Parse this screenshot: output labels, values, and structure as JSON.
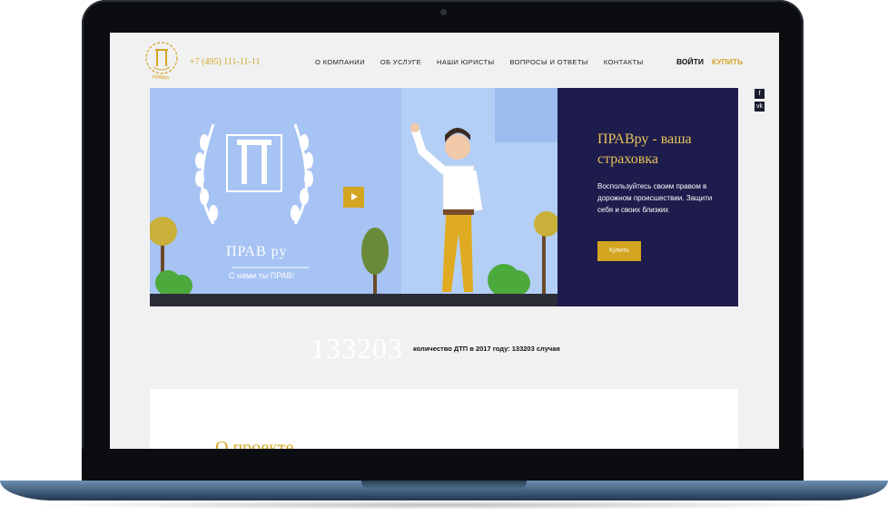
{
  "header": {
    "logo_caption": "ПРАВру",
    "phone": "+7 (495) 111-11-11",
    "nav": [
      "О компании",
      "Об услуге",
      "Наши юристы",
      "Вопросы и ответы",
      "Контакты"
    ],
    "login_label": "ВОЙТИ",
    "buy_label": "КУПИТЬ"
  },
  "social": [
    {
      "icon": "facebook-icon",
      "glyph": "f"
    },
    {
      "icon": "vk-icon",
      "glyph": "vk"
    }
  ],
  "hero": {
    "video_logo_title": "ПРАВ ру",
    "video_logo_slogan": "С нами ты ПРАВ!",
    "panel_title": "ПРАВру - ваша страховка",
    "panel_text": "Воспользуйтесь своим правом в дорожном происшествии. Защити себя и своих близких",
    "panel_button": "Купить"
  },
  "stats": {
    "big_number": "133203",
    "caption": "количество ДТП в 2017 году: 133203 случая"
  },
  "about": {
    "title": "О проекте"
  },
  "colors": {
    "gold": "#d4a520",
    "navy": "#1d1c4c",
    "sky": "#a6c3f3"
  }
}
